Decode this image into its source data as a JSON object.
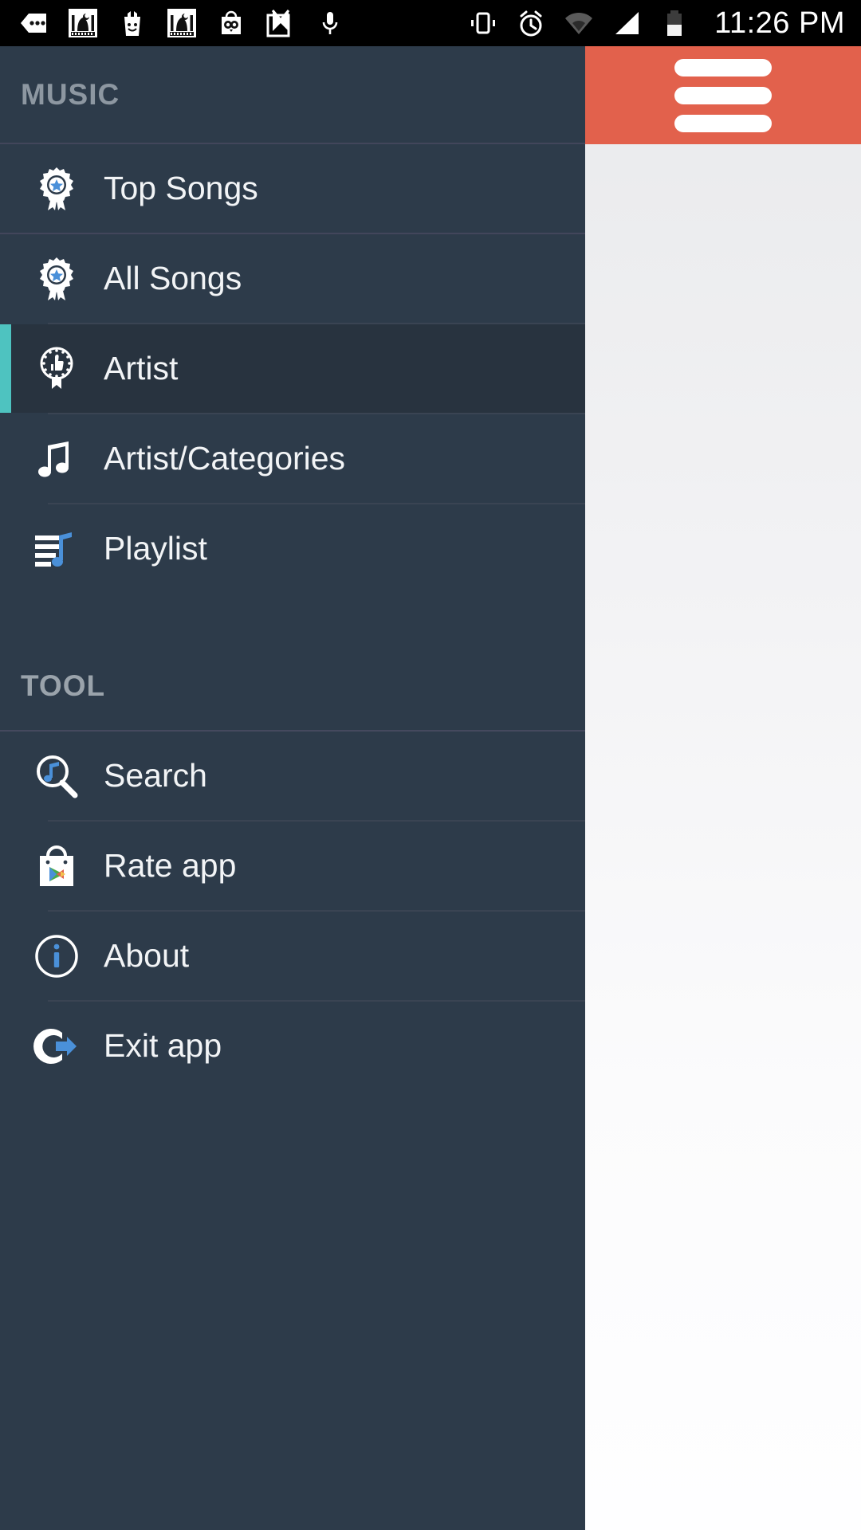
{
  "status_bar": {
    "time": "11:26 PM",
    "notification_icons": [
      {
        "name": "messages-icon"
      },
      {
        "name": "mosque-app-icon"
      },
      {
        "name": "gift-bag-icon"
      },
      {
        "name": "mosque-app-icon-2"
      },
      {
        "name": "owl-bag-icon"
      },
      {
        "name": "gmail-icon"
      },
      {
        "name": "microphone-icon"
      }
    ],
    "system_icons": [
      {
        "name": "vibrate-icon"
      },
      {
        "name": "alarm-clock-icon"
      },
      {
        "name": "wifi-icon"
      },
      {
        "name": "signal-icon"
      },
      {
        "name": "battery-icon"
      }
    ]
  },
  "app_bar": {
    "menu_icon": "hamburger-menu-icon",
    "accent_color": "#e2614c"
  },
  "drawer": {
    "background_color": "#2d3b4a",
    "selected_accent_color": "#4ec3c0",
    "sections": [
      {
        "title": "MUSIC",
        "items": [
          {
            "label": "Top Songs",
            "icon": "award-star-icon",
            "selected": false
          },
          {
            "label": "All Songs",
            "icon": "award-star-icon",
            "selected": false
          },
          {
            "label": "Artist",
            "icon": "award-thumbsup-icon",
            "selected": true
          },
          {
            "label": "Artist/Categories",
            "icon": "music-note-icon",
            "selected": false
          },
          {
            "label": "Playlist",
            "icon": "playlist-icon",
            "selected": false
          }
        ]
      },
      {
        "title": "TOOL",
        "items": [
          {
            "label": "Search",
            "icon": "search-music-icon",
            "selected": false
          },
          {
            "label": "Rate app",
            "icon": "play-store-icon",
            "selected": false
          },
          {
            "label": "About",
            "icon": "info-circle-icon",
            "selected": false
          },
          {
            "label": "Exit app",
            "icon": "exit-arrow-icon",
            "selected": false
          }
        ]
      }
    ]
  }
}
